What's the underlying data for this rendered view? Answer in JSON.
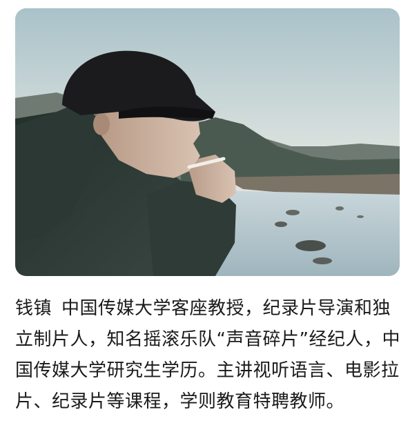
{
  "photo": {
    "subject": "person-smoking-by-river"
  },
  "bio": {
    "name": "钱镇",
    "text": "中国传媒大学客座教授，纪录片导演和独立制片人，知名摇滚乐队“声音碎片”经纪人，中国传媒大学研究生学历。主讲视听语言、电影拉片、纪录片等课程，学则教育特聘教师。"
  }
}
